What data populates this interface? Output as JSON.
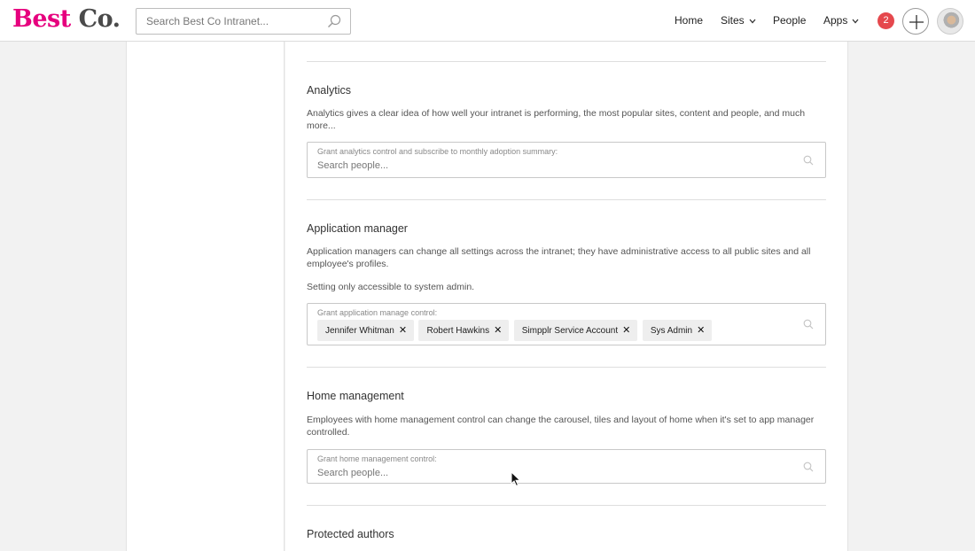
{
  "header": {
    "logo_part1": "Best",
    "logo_part2": "Co.",
    "search_placeholder": "Search Best Co Intranet...",
    "nav": {
      "home": "Home",
      "sites": "Sites",
      "people": "People",
      "apps": "Apps"
    },
    "notification_count": "2"
  },
  "sections": {
    "analytics": {
      "title": "Analytics",
      "description": "Analytics gives a clear idea of how well your intranet is performing, the most popular sites, content and people, and much more...",
      "field_label": "Grant analytics control and subscribe to monthly adoption summary:",
      "placeholder": "Search people..."
    },
    "app_manager": {
      "title": "Application manager",
      "description": "Application managers can change all settings across the intranet; they have administrative access to all public sites and all employee's profiles.",
      "note": "Setting only accessible to system admin.",
      "field_label": "Grant application manage control:",
      "chips": [
        "Jennifer Whitman",
        "Robert Hawkins",
        "Simpplr Service Account",
        "Sys Admin"
      ]
    },
    "home_management": {
      "title": "Home management",
      "description": "Employees with home management control can change the carousel, tiles and layout of home when it's set to app manager controlled.",
      "field_label": "Grant home management control:",
      "placeholder": "Search people..."
    },
    "protected_authors": {
      "title": "Protected authors"
    }
  },
  "icons": {
    "search": "search-icon",
    "chevron": "chevron-down-icon",
    "add": "plus-icon",
    "remove": "close-icon"
  }
}
